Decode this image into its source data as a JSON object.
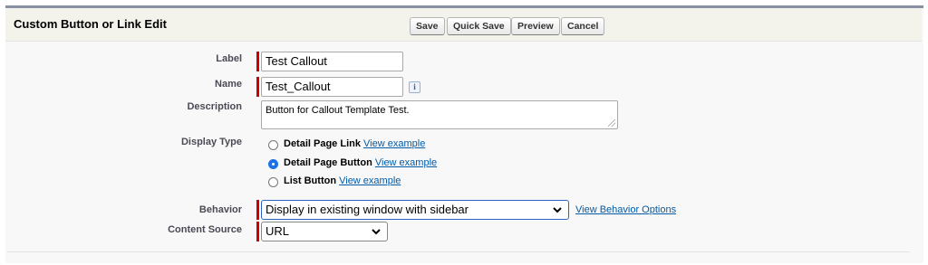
{
  "header": {
    "title": "Custom Button or Link Edit",
    "buttons": {
      "save": "Save",
      "quick_save": "Quick Save",
      "preview": "Preview",
      "cancel": "Cancel"
    }
  },
  "form": {
    "label": {
      "label": "Label",
      "value": "Test Callout"
    },
    "name": {
      "label": "Name",
      "value": "Test_Callout",
      "info_glyph": "i"
    },
    "description": {
      "label": "Description",
      "value": "Button for Callout Template Test."
    },
    "display_type": {
      "label": "Display Type",
      "options": [
        {
          "label": "Detail Page Link",
          "link": "View example",
          "checked": false
        },
        {
          "label": "Detail Page Button",
          "link": "View example",
          "checked": true
        },
        {
          "label": "List Button",
          "link": "View example",
          "checked": false
        }
      ]
    },
    "behavior": {
      "label": "Behavior",
      "value": "Display in existing window with sidebar",
      "link": "View Behavior Options"
    },
    "content_source": {
      "label": "Content Source",
      "value": "URL"
    }
  },
  "colors": {
    "required_bar": "#cc0000",
    "link": "#015ba7",
    "focus_border": "#2b61c0",
    "header_bg": "#f3f3ec"
  },
  "icons": {
    "info": "info-icon",
    "dropdown": "chevron-down-icon"
  }
}
